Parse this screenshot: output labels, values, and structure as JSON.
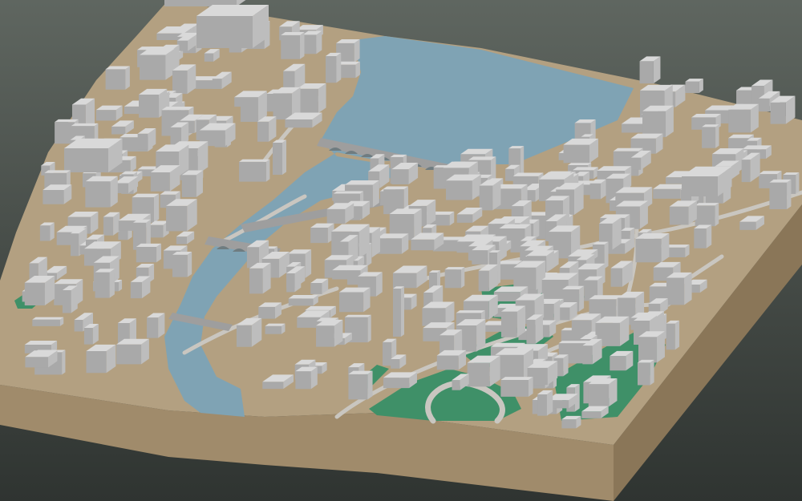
{
  "scene": {
    "subject": "3d-city-block-model",
    "colors": {
      "background_top": "#5f6660",
      "background_bottom": "#2f3431",
      "terrain_top": "#b3a081",
      "terrain_side_left": "#a08b6b",
      "terrain_side_right": "#8a7658",
      "water": "#7fa3b4",
      "park": "#3f9068",
      "building_top": "#d9d9d9",
      "building_left": "#a9a9a9",
      "building_right": "#bdbdbd",
      "road": "#c9c6c0",
      "bridge": "#9e9e9e"
    }
  }
}
